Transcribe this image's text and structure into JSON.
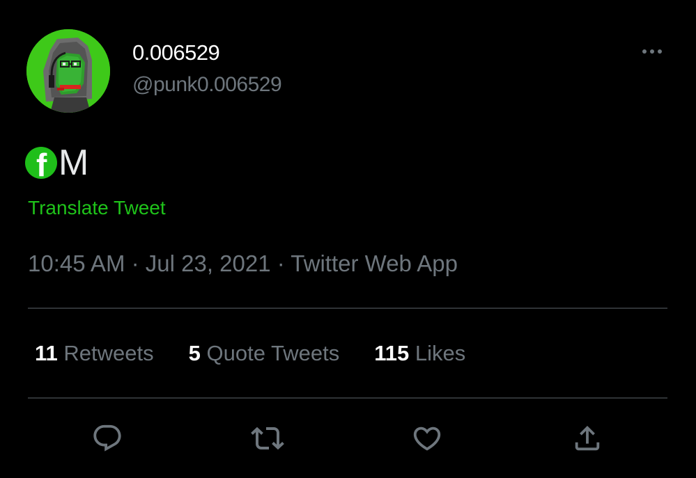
{
  "tweet": {
    "author": {
      "display_name": "0.006529",
      "handle": "@punk0.006529",
      "avatar_icon": "pixel-pepe-avatar-icon"
    },
    "more_icon": "ellipsis-icon",
    "text": "M",
    "text_prefix_icon": "facebook-icon",
    "translate_label": "Translate Tweet",
    "timestamp": "10:45 AM · Jul 23, 2021 · Twitter Web App"
  },
  "stats": [
    {
      "count": "11",
      "label": " Retweets"
    },
    {
      "count": "5",
      "label": " Quote Tweets"
    },
    {
      "count": "115",
      "label": " Likes"
    }
  ],
  "actions": {
    "reply_icon": "reply-icon",
    "retweet_icon": "retweet-icon",
    "like_icon": "heart-icon",
    "share_icon": "share-icon"
  },
  "colors": {
    "background": "#000000",
    "accent": "#1fc31a",
    "muted": "#6e767d",
    "divider": "#2f3336"
  }
}
